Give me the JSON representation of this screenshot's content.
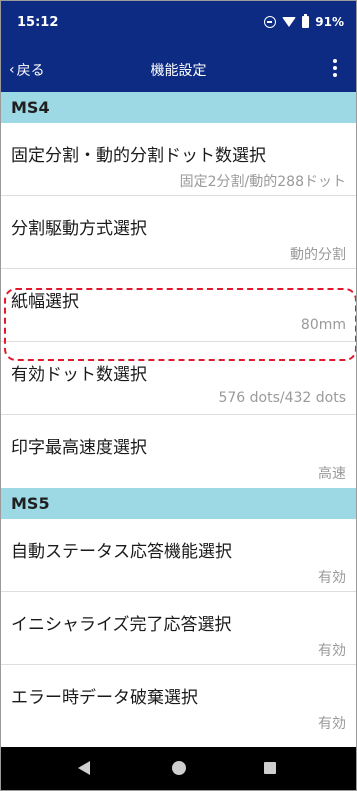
{
  "status_bar": {
    "time": "15:12",
    "battery": "91%",
    "icons": [
      "do-not-disturb-icon",
      "wifi-icon",
      "battery-icon"
    ]
  },
  "app_bar": {
    "back_label": "戻る",
    "title": "機能設定",
    "menu_icon": "more-vert-icon"
  },
  "sections": [
    {
      "header": "MS4",
      "items": [
        {
          "label": "固定分割・動的分割ドット数選択",
          "value": "固定2分割/動的288ドット"
        },
        {
          "label": "分割駆動方式選択",
          "value": "動的分割"
        },
        {
          "label": "紙幅選択",
          "value": "80mm"
        },
        {
          "label": "有効ドット数選択",
          "value": "576 dots/432 dots"
        },
        {
          "label": "印字最高速度選択",
          "value": "高速"
        }
      ]
    },
    {
      "header": "MS5",
      "items": [
        {
          "label": "自動ステータス応答機能選択",
          "value": "有効"
        },
        {
          "label": "イニシャライズ完了応答選択",
          "value": "有効"
        },
        {
          "label": "エラー時データ破棄選択",
          "value": "有効"
        }
      ]
    }
  ],
  "highlight_color": "#e2182d",
  "header_color": "#0d2b83",
  "section_color": "#9dd9e5"
}
